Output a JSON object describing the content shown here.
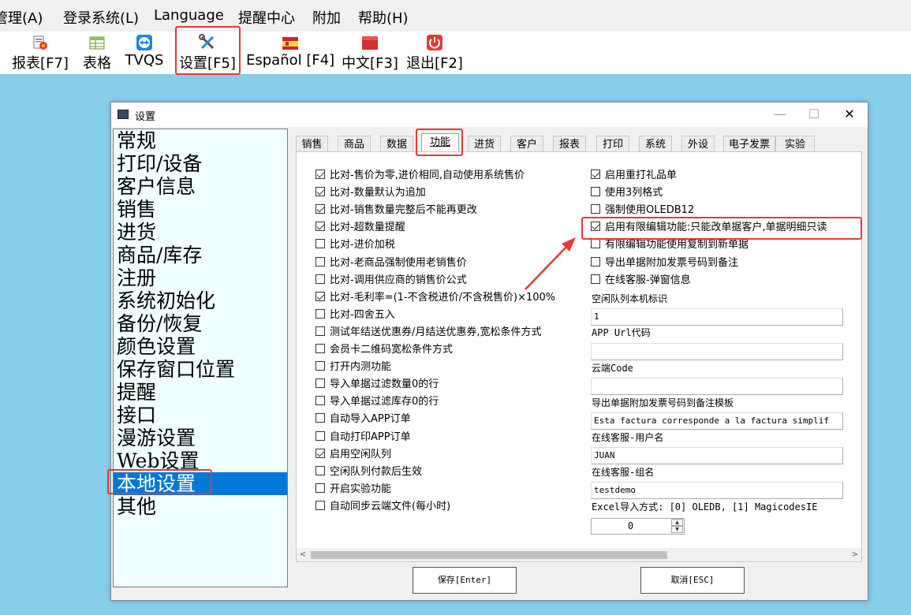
{
  "menubar": {
    "items": [
      "管理(A)",
      "登录系统(L)",
      "Language",
      "提醒中心",
      "附加",
      "帮助(H)"
    ]
  },
  "toolbar": {
    "buttons": [
      {
        "label": "报表[F7]",
        "icon": "report-icon"
      },
      {
        "label": "表格",
        "icon": "table-icon"
      },
      {
        "label": "TVQS",
        "icon": "teamviewer-icon"
      },
      {
        "label": "设置[F5]",
        "icon": "settings-tools-icon"
      },
      {
        "label": "Español [F4]",
        "icon": "spain-flag-icon"
      },
      {
        "label": "中文[F3]",
        "icon": "china-flag-icon"
      },
      {
        "label": "退出[F2]",
        "icon": "power-icon"
      }
    ]
  },
  "dialog": {
    "title": "设置",
    "minimize": "—",
    "maximize": "☐",
    "close": "✕"
  },
  "categories": {
    "items": [
      "常规",
      "打印/设备",
      "客户信息",
      "销售",
      "进货",
      "商品/库存",
      "注册",
      "系统初始化",
      "备份/恢复",
      "颜色设置",
      "保存窗口位置",
      "提醒",
      "接口",
      "漫游设置",
      "Web设置",
      "本地设置",
      "其他"
    ],
    "selected": "本地设置"
  },
  "tabs": {
    "items": [
      "销售",
      "商品",
      "数据",
      "功能",
      "进货",
      "客户",
      "报表",
      "打印",
      "系统",
      "外设",
      "电子发票",
      "实验"
    ],
    "active": "功能"
  },
  "left_options": [
    {
      "label": "比对-售价为零,进价相同,自动使用系统售价",
      "checked": true
    },
    {
      "label": "比对-数量默认为追加",
      "checked": true
    },
    {
      "label": "比对-销售数量完整后不能再更改",
      "checked": true
    },
    {
      "label": "比对-超数量提醒",
      "checked": true
    },
    {
      "label": "比对-进价加税",
      "checked": false
    },
    {
      "label": "比对-老商品强制使用老销售价",
      "checked": false
    },
    {
      "label": "比对-调用供应商的销售价公式",
      "checked": false
    },
    {
      "label": "比对-毛利率=(1-不含税进价/不含税售价)×100%",
      "checked": true
    },
    {
      "label": "比对-四舍五入",
      "checked": false
    },
    {
      "label": "测试年结送优惠券/月结送优惠券,宽松条件方式",
      "checked": false
    },
    {
      "label": "会员卡二维码宽松条件方式",
      "checked": false
    },
    {
      "label": "打开内测功能",
      "checked": false
    },
    {
      "label": "导入单据过滤数量0的行",
      "checked": false
    },
    {
      "label": "导入单据过滤库存0的行",
      "checked": false
    },
    {
      "label": "自动导入APP订单",
      "checked": false
    },
    {
      "label": "自动打印APP订单",
      "checked": false
    },
    {
      "label": "启用空闲队列",
      "checked": true
    },
    {
      "label": "空闲队列付款后生效",
      "checked": false
    },
    {
      "label": "开启实验功能",
      "checked": false
    },
    {
      "label": "自动同步云端文件(每小时)",
      "checked": false
    }
  ],
  "right_options": [
    {
      "label": "启用重打礼品单",
      "checked": true
    },
    {
      "label": "使用3列格式",
      "checked": false
    },
    {
      "label": "强制使用OLEDB12",
      "checked": false
    },
    {
      "label": "启用有限编辑功能:只能改单据客户,单据明细只读",
      "checked": true
    },
    {
      "label": "有限编辑功能使用复制到新单据",
      "checked": false
    },
    {
      "label": "导出单据附加发票号码到备注",
      "checked": false
    },
    {
      "label": "在线客服-弹窗信息",
      "checked": false
    }
  ],
  "fields": [
    {
      "label": "空闲队列本机标识",
      "value": "1"
    },
    {
      "label": "APP Url代码",
      "value": ""
    },
    {
      "label": "云端Code",
      "value": ""
    },
    {
      "label": "导出单据附加发票号码到备注模板",
      "value": "Esta factura corresponde a la factura simplif"
    },
    {
      "label": "在线客服-用户名",
      "value": "JUAN"
    },
    {
      "label": "在线客服-组名",
      "value": "testdemo"
    }
  ],
  "excel_import": {
    "label": "Excel导入方式: [0] OLEDB, [1] MagicodesIE",
    "value": "0"
  },
  "scrollbar": {
    "left_arrow": "<",
    "right_arrow": ">"
  },
  "buttons": {
    "save": "保存[Enter]",
    "cancel": "取消[ESC]"
  },
  "colors": {
    "desktop": "#87ceeb",
    "selection": "#0078d7",
    "highlight": "#e53935"
  }
}
